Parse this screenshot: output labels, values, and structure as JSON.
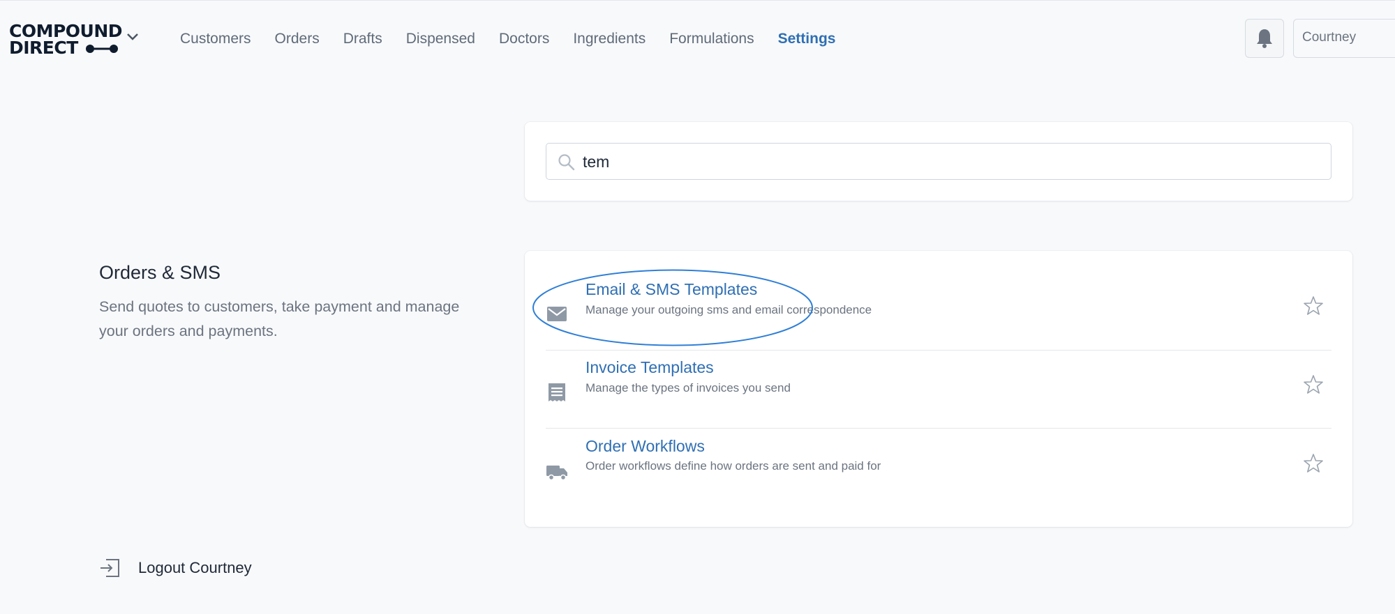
{
  "header": {
    "logo_line1": "COMPOUND",
    "logo_line2": "DIRECT",
    "nav": [
      {
        "label": "Customers",
        "active": false
      },
      {
        "label": "Orders",
        "active": false
      },
      {
        "label": "Drafts",
        "active": false
      },
      {
        "label": "Dispensed",
        "active": false
      },
      {
        "label": "Doctors",
        "active": false
      },
      {
        "label": "Ingredients",
        "active": false
      },
      {
        "label": "Formulations",
        "active": false
      },
      {
        "label": "Settings",
        "active": true
      }
    ],
    "notification_icon": "bell-icon",
    "user": "Courtney"
  },
  "search": {
    "value": "tem",
    "icon": "search-icon"
  },
  "section": {
    "title": "Orders & SMS",
    "description": "Send quotes to customers, take payment and manage your orders and payments."
  },
  "items": [
    {
      "title": "Email & SMS Templates",
      "description": "Manage your outgoing sms and email correspondence",
      "icon": "envelope-icon",
      "highlighted": true
    },
    {
      "title": "Invoice Templates",
      "description": "Manage the types of invoices you send",
      "icon": "receipt-icon",
      "highlighted": false
    },
    {
      "title": "Order Workflows",
      "description": "Order workflows define how orders are sent and paid for",
      "icon": "truck-icon",
      "highlighted": false
    }
  ],
  "logout": {
    "label": "Logout Courtney",
    "icon": "logout-icon"
  },
  "colors": {
    "accent": "#2f6fb3",
    "highlight_ring": "#2f7fd6",
    "background": "#f8f9fb"
  }
}
